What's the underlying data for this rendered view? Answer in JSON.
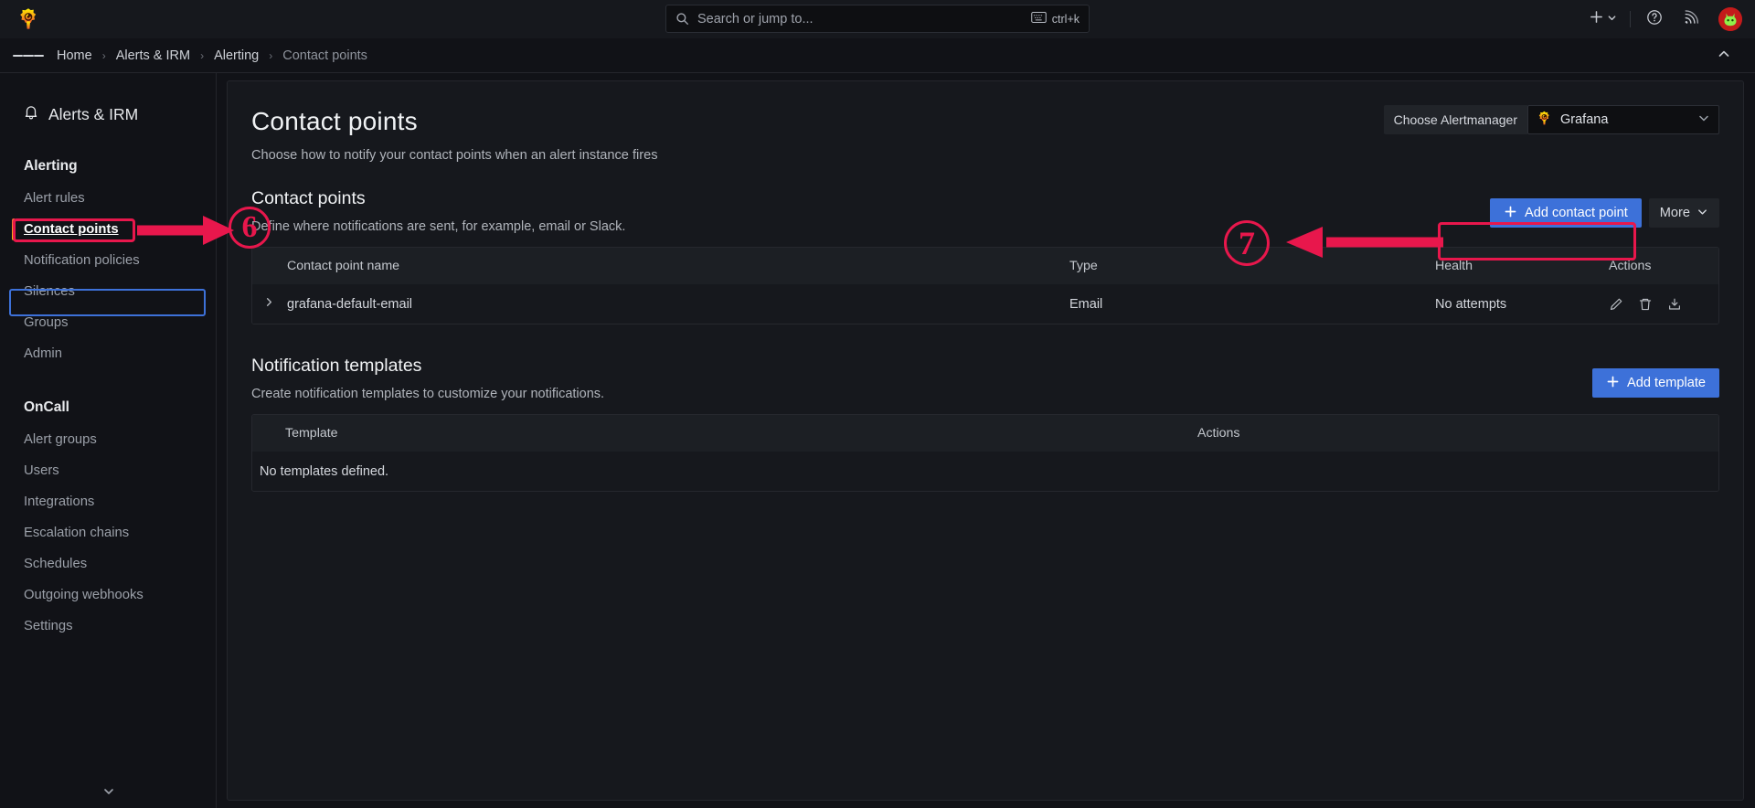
{
  "topbar": {
    "logo_icon": "grafana-logo-icon",
    "search": {
      "placeholder": "Search or jump to...",
      "icon": "search-icon",
      "shortcut": "ctrl+k",
      "shortcut_icon": "keyboard-icon"
    },
    "add_icon": "plus-icon",
    "add_chevron_icon": "chevron-down-icon",
    "help_icon": "help-circle-icon",
    "news_icon": "rss-icon",
    "avatar_icon": "user-avatar-icon"
  },
  "breadcrumb": {
    "menu_icon": "hamburger-menu-icon",
    "separator": "›",
    "collapse_icon": "chevron-up-icon",
    "items": [
      {
        "label": "Home",
        "current": false
      },
      {
        "label": "Alerts & IRM",
        "current": false
      },
      {
        "label": "Alerting",
        "current": false
      },
      {
        "label": "Contact points",
        "current": true
      }
    ]
  },
  "sidebar": {
    "title": "Alerts & IRM",
    "title_icon": "bell-icon",
    "expand_icon": "chevron-down-icon",
    "groups": [
      {
        "label": "Alerting",
        "items": [
          {
            "label": "Alert rules",
            "active": false
          },
          {
            "label": "Contact points",
            "active": true
          },
          {
            "label": "Notification policies",
            "active": false
          },
          {
            "label": "Silences",
            "active": false
          },
          {
            "label": "Groups",
            "active": false
          },
          {
            "label": "Admin",
            "active": false
          }
        ]
      },
      {
        "label": "OnCall",
        "items": [
          {
            "label": "Alert groups",
            "active": false
          },
          {
            "label": "Users",
            "active": false
          },
          {
            "label": "Integrations",
            "active": false
          },
          {
            "label": "Escalation chains",
            "active": false
          },
          {
            "label": "Schedules",
            "active": false
          },
          {
            "label": "Outgoing webhooks",
            "active": false
          },
          {
            "label": "Settings",
            "active": false
          }
        ]
      }
    ]
  },
  "page": {
    "title": "Contact points",
    "subtitle": "Choose how to notify your contact points when an alert instance fires",
    "alertmanager": {
      "label": "Choose Alertmanager",
      "selected": "Grafana",
      "option_icon": "grafana-logo-icon",
      "chevron_icon": "chevron-down-icon"
    }
  },
  "contact_points_section": {
    "title": "Contact points",
    "subtitle": "Define where notifications are sent, for example, email or Slack.",
    "add_button": "Add contact point",
    "add_button_icon": "plus-icon",
    "more_button": "More",
    "more_button_icon": "chevron-down-icon",
    "columns": [
      "Contact point name",
      "Type",
      "Health",
      "Actions"
    ],
    "rows": [
      {
        "expand_icon": "chevron-right-icon",
        "name": "grafana-default-email",
        "type": "Email",
        "health": "No attempts",
        "actions": [
          "edit-pencil-icon",
          "delete-trash-icon",
          "export-icon"
        ]
      }
    ]
  },
  "templates_section": {
    "title": "Notification templates",
    "subtitle": "Create notification templates to customize your notifications.",
    "add_button": "Add template",
    "add_button_icon": "plus-icon",
    "columns": [
      "Template",
      "Actions"
    ],
    "empty_message": "No templates defined."
  },
  "annotations": {
    "accent_color": "#e8174c",
    "markers": [
      {
        "number": "6",
        "target": "sidebar-item-contact-points"
      },
      {
        "number": "7",
        "target": "add-contact-point-button"
      }
    ]
  }
}
